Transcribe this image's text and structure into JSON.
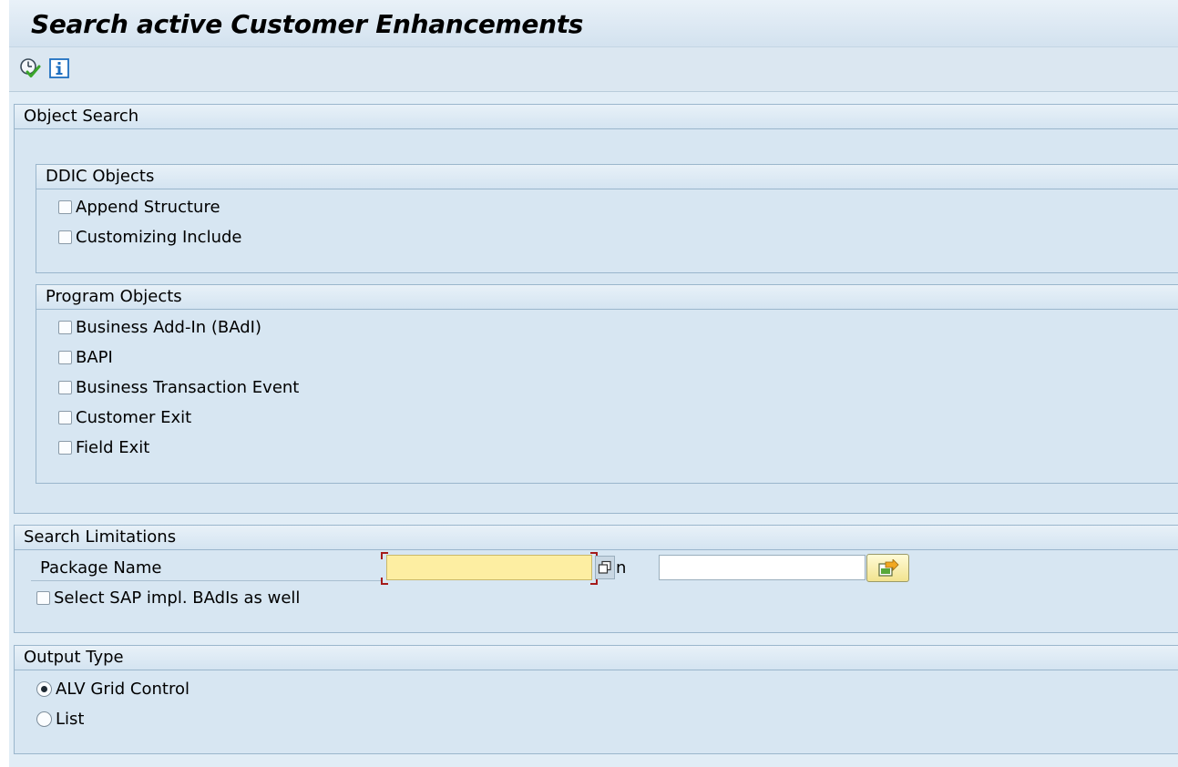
{
  "window": {
    "title": "Search active Customer Enhancements"
  },
  "toolbar": {
    "buttons": [
      {
        "icon": "execute-icon",
        "tooltip": ""
      },
      {
        "icon": "info-icon",
        "tooltip": ""
      }
    ]
  },
  "object_search": {
    "title": "Object Search",
    "ddic": {
      "title": "DDIC Objects",
      "items": [
        {
          "label": "Append Structure",
          "checked": false
        },
        {
          "label": "Customizing Include",
          "checked": false
        }
      ]
    },
    "program": {
      "title": "Program Objects",
      "items": [
        {
          "label": "Business Add-In (BAdI)",
          "checked": false
        },
        {
          "label": "BAPI",
          "checked": false
        },
        {
          "label": "Business Transaction Event",
          "checked": false
        },
        {
          "label": "Customer Exit",
          "checked": false
        },
        {
          "label": "Field Exit",
          "checked": false
        }
      ]
    }
  },
  "search_limitations": {
    "title": "Search Limitations",
    "package_label": "Package Name",
    "package_from": "",
    "to_label": "n",
    "package_to": "",
    "sap_badis_label": "Select SAP impl. BAdIs as well",
    "sap_badis_checked": false
  },
  "output_type": {
    "title": "Output Type",
    "options": [
      {
        "label": "ALV Grid Control",
        "selected": true
      },
      {
        "label": "List",
        "selected": false
      }
    ]
  },
  "colors": {
    "accent_yellow": "#fdeea2",
    "focus_red": "#a51b1b"
  }
}
